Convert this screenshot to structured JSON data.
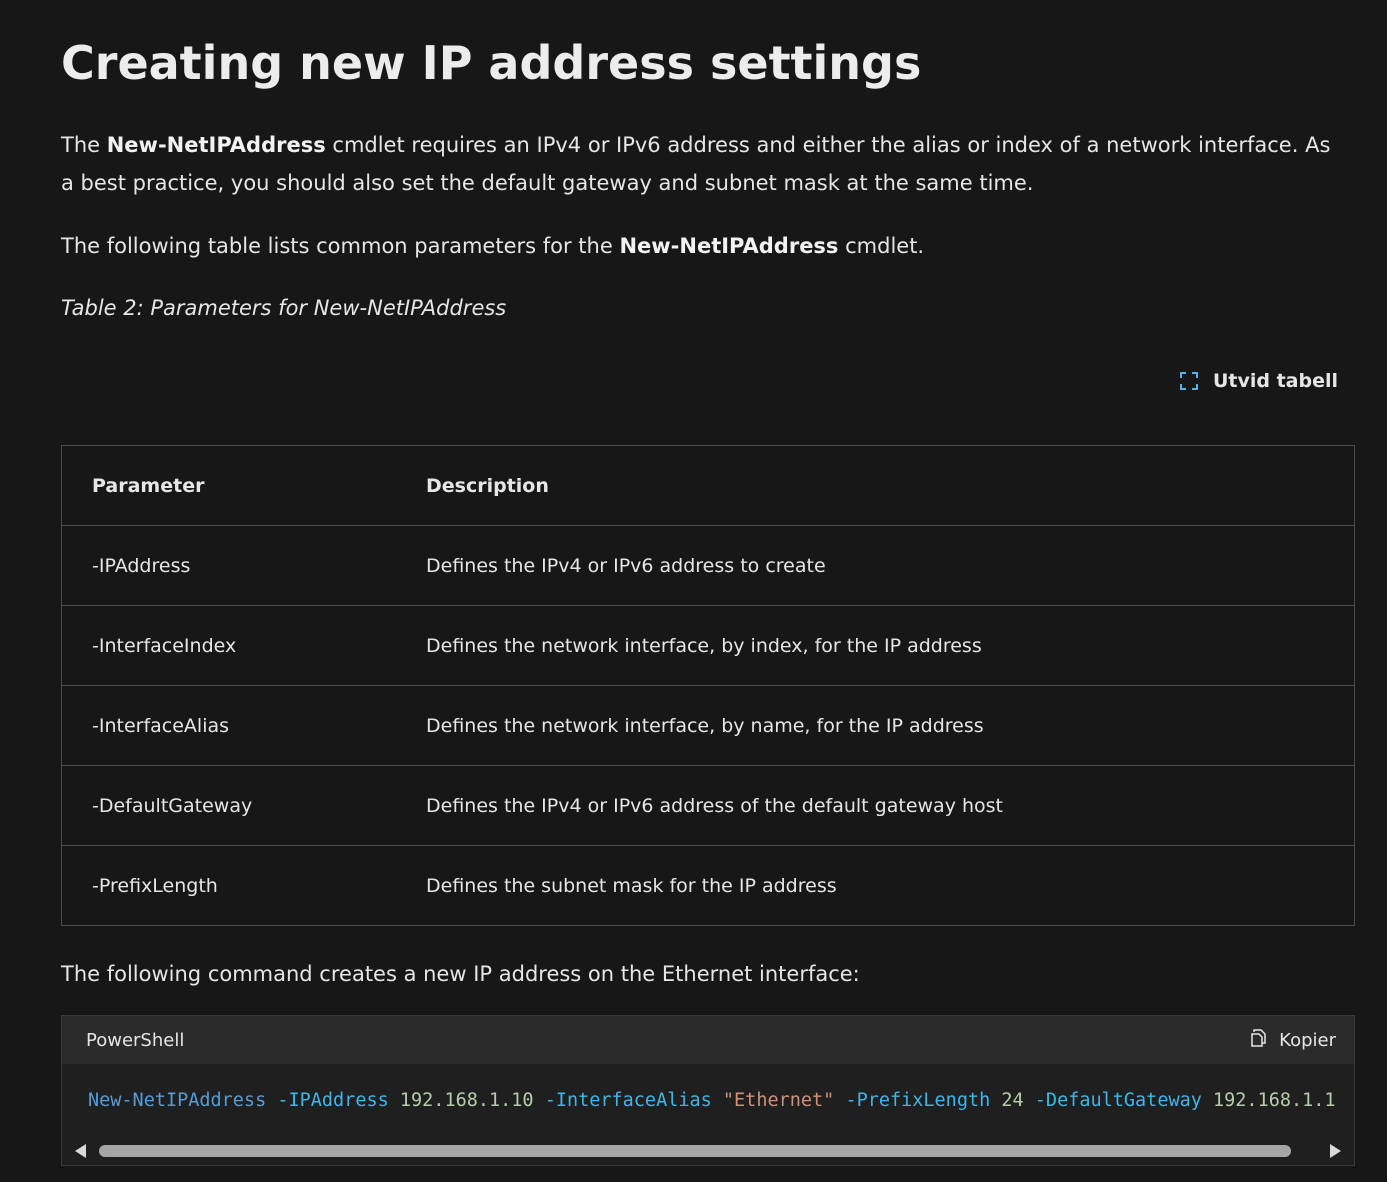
{
  "heading": "Creating new IP address settings",
  "intro": {
    "before": "The ",
    "bold": "New-NetIPAddress",
    "after": " cmdlet requires an IPv4 or IPv6 address and either the alias or index of a network interface. As a best practice, you should also set the default gateway and subnet mask at the same time."
  },
  "table_intro": {
    "before": "The following table lists common parameters for the ",
    "bold": "New-NetIPAddress",
    "after": " cmdlet."
  },
  "table_caption": "Table 2: Parameters for New-NetIPAddress",
  "expand_label": "Utvid tabell",
  "table": {
    "headers": [
      "Parameter",
      "Description"
    ],
    "rows": [
      [
        "-IPAddress",
        "Defines the IPv4 or IPv6 address to create"
      ],
      [
        "-InterfaceIndex",
        "Defines the network interface, by index, for the IP address"
      ],
      [
        "-InterfaceAlias",
        "Defines the network interface, by name, for the IP address"
      ],
      [
        "-DefaultGateway",
        "Defines the IPv4 or IPv6 address of the default gateway host"
      ],
      [
        "-PrefixLength",
        "Defines the subnet mask for the IP address"
      ]
    ]
  },
  "command_intro": "The following command creates a new IP address on the Ethernet interface:",
  "code": {
    "language": "PowerShell",
    "copy_label": "Kopier",
    "tokens": {
      "cmd": "New-NetIPAddress",
      "p1": "-IPAddress",
      "v1": "192.168.1.10",
      "p2": "-InterfaceAlias",
      "v2": "\"Ethernet\"",
      "p3": "-PrefixLength",
      "v3": "24",
      "p4": "-DefaultGateway",
      "v4": "192.168.1.1"
    }
  },
  "colors": {
    "background": "#171717",
    "cmdlet": "#569cd6",
    "parameter": "#3fb6e8",
    "number": "#b5cea8",
    "string": "#ce9178"
  }
}
